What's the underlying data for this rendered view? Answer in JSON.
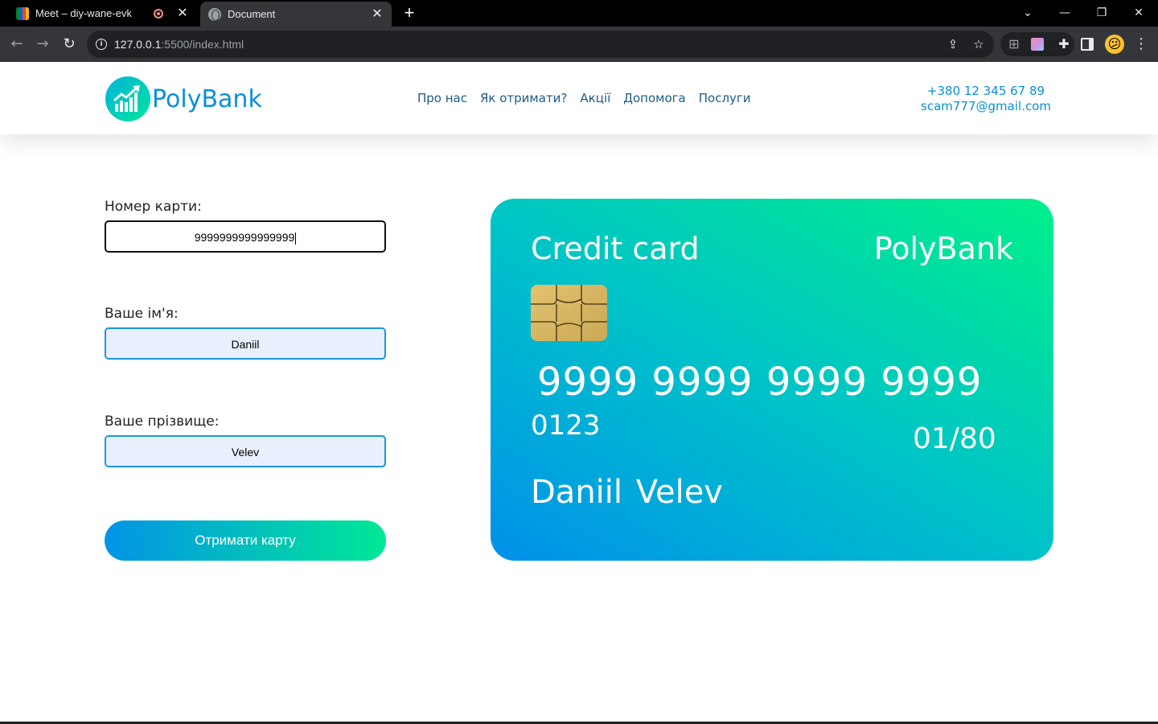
{
  "browser": {
    "tabs": [
      {
        "title": "Meet – diy-wane-evk",
        "icon": "google-meet-icon",
        "recording": true
      },
      {
        "title": "Document",
        "icon": "globe-icon",
        "active": true
      }
    ],
    "url_host": "127.0.0.1",
    "url_rest": ":5500/index.html"
  },
  "site": {
    "logo_text": "PolyBank",
    "nav": [
      "Про нас",
      "Як отримати?",
      "Акції",
      "Допомога",
      "Послуги"
    ],
    "phone": "+380 12 345 67 89",
    "email": "scam777@gmail.com"
  },
  "form": {
    "card_number_label": "Номер карти:",
    "card_number_value": "9999999999999999",
    "first_name_label": "Ваше ім'я:",
    "first_name_value": "Daniil",
    "last_name_label": "Ваше прізвище:",
    "last_name_value": "Velev",
    "submit_label": "Отримати карту"
  },
  "card": {
    "label": "Credit card",
    "brand": "PolyBank",
    "number": "9999 9999 9999 9999",
    "cvv": "0123",
    "expiry": "01/80",
    "holder": "Daniil Velev"
  },
  "colors": {
    "brand_blue": "#0a8fd8",
    "gradient_start": "#0091ea",
    "gradient_end": "#00f08a"
  }
}
